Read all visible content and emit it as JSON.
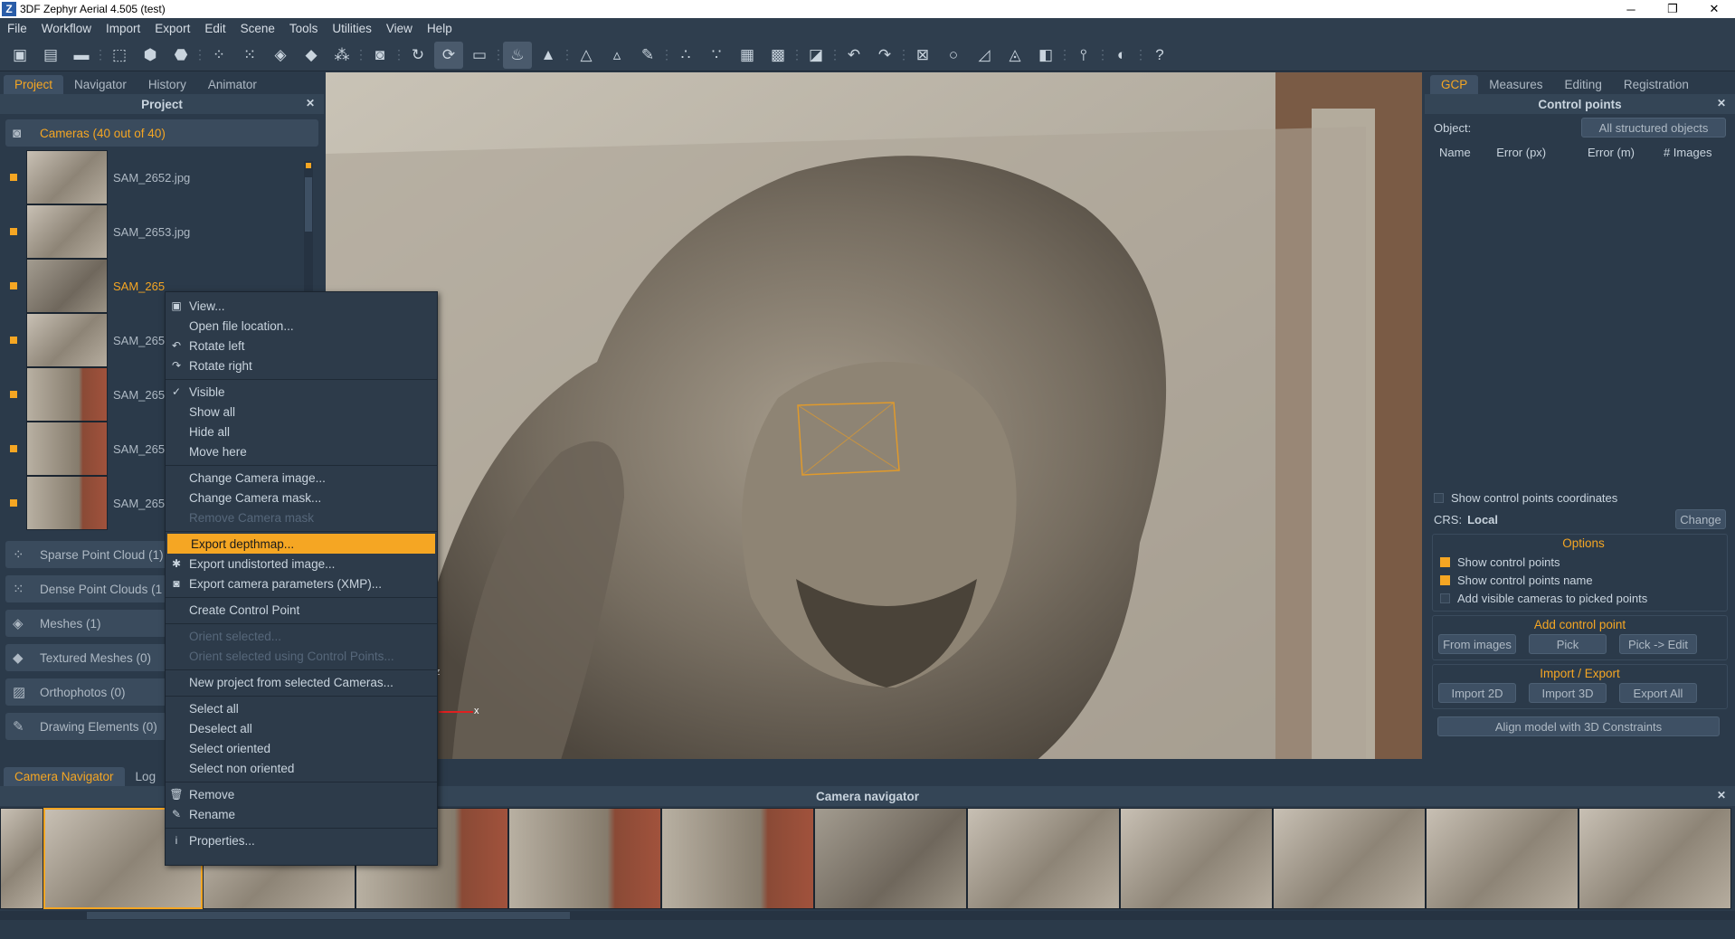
{
  "window": {
    "title": "3DF Zephyr Aerial 4.505 (test)",
    "logo": "Z",
    "min": "─",
    "max": "❐",
    "close": "✕"
  },
  "menu": [
    "File",
    "Workflow",
    "Import",
    "Export",
    "Edit",
    "Scene",
    "Tools",
    "Utilities",
    "View",
    "Help"
  ],
  "toolbar": {
    "icons": [
      "new-project-icon",
      "open-icon",
      "save-icon",
      "sep",
      "select-icon",
      "cube-icon",
      "cube-solid-icon",
      "sep",
      "sparse-icon",
      "dense-icon",
      "mesh-icon",
      "textured-icon",
      "points-icon",
      "sep",
      "camera-icon",
      "sep",
      "orbit-icon",
      "rotate-icon",
      "image-icon",
      "sep",
      "light-icon",
      "color-icon",
      "sep",
      "triangle-icon",
      "triangle2-icon",
      "brush-icon",
      "sep",
      "dots-icon",
      "dots2-icon",
      "box-icon",
      "box2-icon",
      "sep",
      "crop-icon",
      "sep",
      "undo-icon",
      "redo-icon",
      "sep",
      "transform-icon",
      "circle-icon",
      "plane-icon",
      "measure-icon",
      "cube-red-icon",
      "sep",
      "pin-icon",
      "sep",
      "mask-icon",
      "sep",
      "help-icon"
    ],
    "glyphs": {
      "new-project-icon": "▣",
      "open-icon": "▤",
      "save-icon": "▬",
      "sep": "⋮",
      "select-icon": "⬚",
      "cube-icon": "⬢",
      "cube-solid-icon": "⬣",
      "sparse-icon": "⁘",
      "dense-icon": "⁙",
      "mesh-icon": "◈",
      "textured-icon": "◆",
      "points-icon": "⁂",
      "camera-icon": "◙",
      "orbit-icon": "↻",
      "rotate-icon": "⟳",
      "image-icon": "▭",
      "light-icon": "♨",
      "color-icon": "▲",
      "triangle-icon": "△",
      "triangle2-icon": "▵",
      "brush-icon": "✎",
      "dots-icon": "∴",
      "dots2-icon": "∵",
      "box-icon": "▦",
      "box2-icon": "▩",
      "crop-icon": "◪",
      "undo-icon": "↶",
      "redo-icon": "↷",
      "transform-icon": "⊠",
      "circle-icon": "○",
      "plane-icon": "◿",
      "measure-icon": "◬",
      "cube-red-icon": "◧",
      "pin-icon": "⫯",
      "mask-icon": "◐",
      "help-icon": "?"
    }
  },
  "left": {
    "tabs": [
      "Project",
      "Navigator",
      "History",
      "Animator"
    ],
    "title": "Project",
    "close": "✕",
    "cameras_label": "Cameras (40 out of 40)",
    "cameras": [
      {
        "name": "SAM_2652.jpg",
        "selected": false
      },
      {
        "name": "SAM_2653.jpg",
        "selected": false
      },
      {
        "name": "SAM_265",
        "selected": true
      },
      {
        "name": "SAM_265",
        "selected": false
      },
      {
        "name": "SAM_265",
        "selected": false
      },
      {
        "name": "SAM_265",
        "selected": false
      },
      {
        "name": "SAM_265",
        "selected": false
      }
    ],
    "groups": [
      {
        "icon": "sparse-icon",
        "glyph": "⁘",
        "label": "Sparse Point Cloud (1)"
      },
      {
        "icon": "dense-icon",
        "glyph": "⁙",
        "label": "Dense Point Clouds (1"
      },
      {
        "icon": "mesh-icon",
        "glyph": "◈",
        "label": "Meshes (1)"
      },
      {
        "icon": "textured-mesh-icon",
        "glyph": "◆",
        "label": "Textured Meshes (0)"
      },
      {
        "icon": "orthophoto-icon",
        "glyph": "▨",
        "label": "Orthophotos (0)"
      },
      {
        "icon": "drawing-icon",
        "glyph": "✎",
        "label": "Drawing Elements (0)"
      }
    ]
  },
  "viewport": {
    "axis_z": "z",
    "axis_x": "x"
  },
  "context_menu": [
    {
      "label": "View...",
      "icon": "▣",
      "state": "normal"
    },
    {
      "label": "Open file location...",
      "state": "normal"
    },
    {
      "label": "Rotate left",
      "icon": "↶",
      "state": "normal"
    },
    {
      "label": "Rotate right",
      "icon": "↷",
      "state": "normal"
    },
    {
      "sep": true
    },
    {
      "label": "Visible",
      "icon": "✓",
      "state": "normal"
    },
    {
      "label": "Show all",
      "state": "normal"
    },
    {
      "label": "Hide all",
      "state": "normal"
    },
    {
      "label": "Move here",
      "state": "normal"
    },
    {
      "sep": true
    },
    {
      "label": "Change Camera image...",
      "state": "normal"
    },
    {
      "label": "Change Camera mask...",
      "state": "normal"
    },
    {
      "label": "Remove Camera mask",
      "state": "disabled"
    },
    {
      "sep": true
    },
    {
      "label": "Export depthmap...",
      "state": "highlighted"
    },
    {
      "label": "Export undistorted image...",
      "icon": "✱",
      "state": "normal"
    },
    {
      "label": "Export camera parameters (XMP)...",
      "icon": "◙",
      "state": "normal"
    },
    {
      "sep": true
    },
    {
      "label": "Create Control Point",
      "state": "normal"
    },
    {
      "sep": true
    },
    {
      "label": "Orient selected...",
      "state": "disabled"
    },
    {
      "label": "Orient selected using Control Points...",
      "state": "disabled"
    },
    {
      "sep": true
    },
    {
      "label": "New project from selected Cameras...",
      "state": "normal"
    },
    {
      "sep": true
    },
    {
      "label": "Select all",
      "state": "normal"
    },
    {
      "label": "Deselect all",
      "state": "normal"
    },
    {
      "label": "Select oriented",
      "state": "normal"
    },
    {
      "label": "Select non oriented",
      "state": "normal"
    },
    {
      "sep": true
    },
    {
      "label": "Remove",
      "icon": "🗑",
      "state": "normal"
    },
    {
      "label": "Rename",
      "icon": "✎",
      "state": "normal"
    },
    {
      "sep": true
    },
    {
      "label": "Properties...",
      "icon": "i",
      "state": "normal"
    }
  ],
  "right": {
    "tabs": [
      "GCP",
      "Measures",
      "Editing",
      "Registration"
    ],
    "title": "Control points",
    "close": "✕",
    "object_label": "Object:",
    "object_value": "All structured objects",
    "columns": [
      "Name",
      "Error (px)",
      "Error (m)",
      "# Images"
    ],
    "show_coords": "Show control points coordinates",
    "crs_label": "CRS:",
    "crs_value": "Local",
    "change": "Change",
    "options_title": "Options",
    "options": [
      {
        "label": "Show control points",
        "checked": true
      },
      {
        "label": "Show control points name",
        "checked": true
      },
      {
        "label": "Add visible cameras to picked points",
        "checked": false
      }
    ],
    "add_title": "Add control point",
    "add_buttons": [
      "From images",
      "Pick",
      "Pick -> Edit"
    ],
    "io_title": "Import / Export",
    "io_buttons": [
      "Import 2D",
      "Import 3D",
      "Export All"
    ],
    "align": "Align model with 3D Constraints"
  },
  "bottom": {
    "tabs": [
      "Camera Navigator",
      "Log"
    ],
    "title": "Camera navigator",
    "close": "✕",
    "frames": 12
  },
  "colors": {
    "accent": "#f5a623",
    "panel": "#2b3a4a",
    "menu_bg": "#2d3b4a"
  }
}
